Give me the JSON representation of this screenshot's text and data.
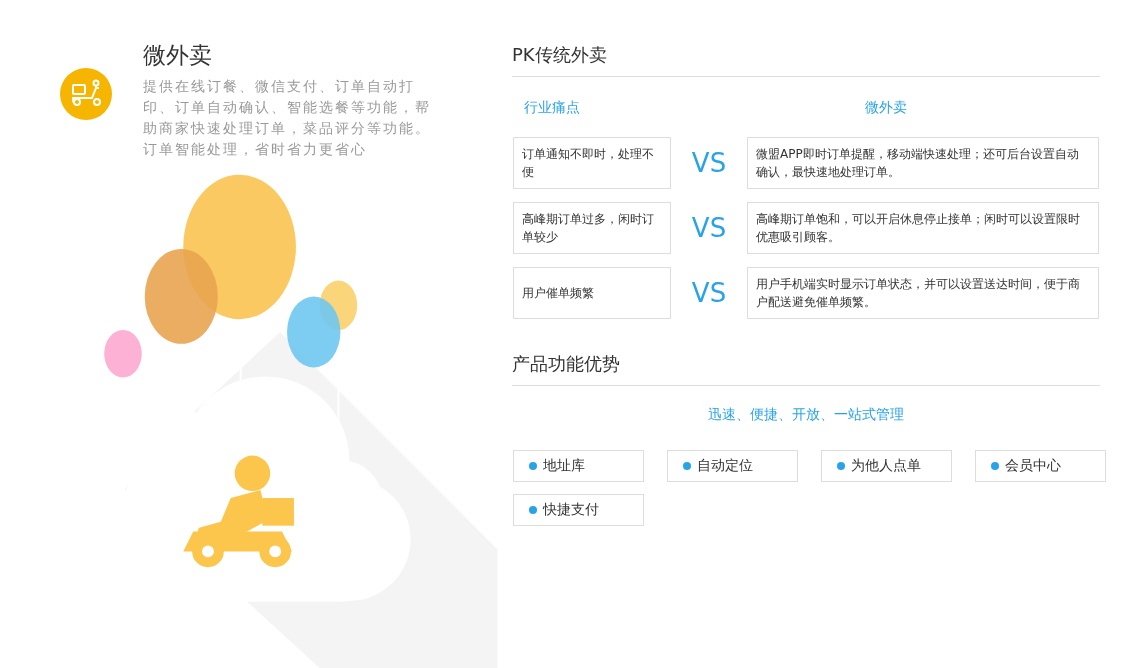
{
  "product": {
    "title": "微外卖",
    "description": "提供在线订餐、微信支付、订单自动打印、订单自动确认、智能选餐等功能，帮助商家快速处理订单，菜品评分等功能。订单智能处理，省时省力更省心"
  },
  "comparison": {
    "heading": "PK传统外卖",
    "columns": [
      "行业痛点",
      "微外卖"
    ],
    "rows": [
      {
        "problem": "订单通知不即时，处理不便",
        "vs": "VS",
        "solution": "微盟APP即时订单提醒，移动端快速处理；还可后台设置自动确认，最快速地处理订单。"
      },
      {
        "problem": "高峰期订单过多，闲时订单较少",
        "vs": "VS",
        "solution": "高峰期订单饱和，可以开启休息停止接单；闲时可以设置限时优惠吸引顾客。"
      },
      {
        "problem": "用户催单频繁",
        "vs": "VS",
        "solution": "用户手机端实时显示订单状态，并可以设置送达时间，便于商户配送避免催单频繁。"
      }
    ]
  },
  "advantages": {
    "heading": "产品功能优势",
    "tagline": "迅速、便捷、开放、一站式管理",
    "features": [
      "地址库",
      "自动定位",
      "为他人点单",
      "会员中心",
      "快捷支付"
    ]
  }
}
